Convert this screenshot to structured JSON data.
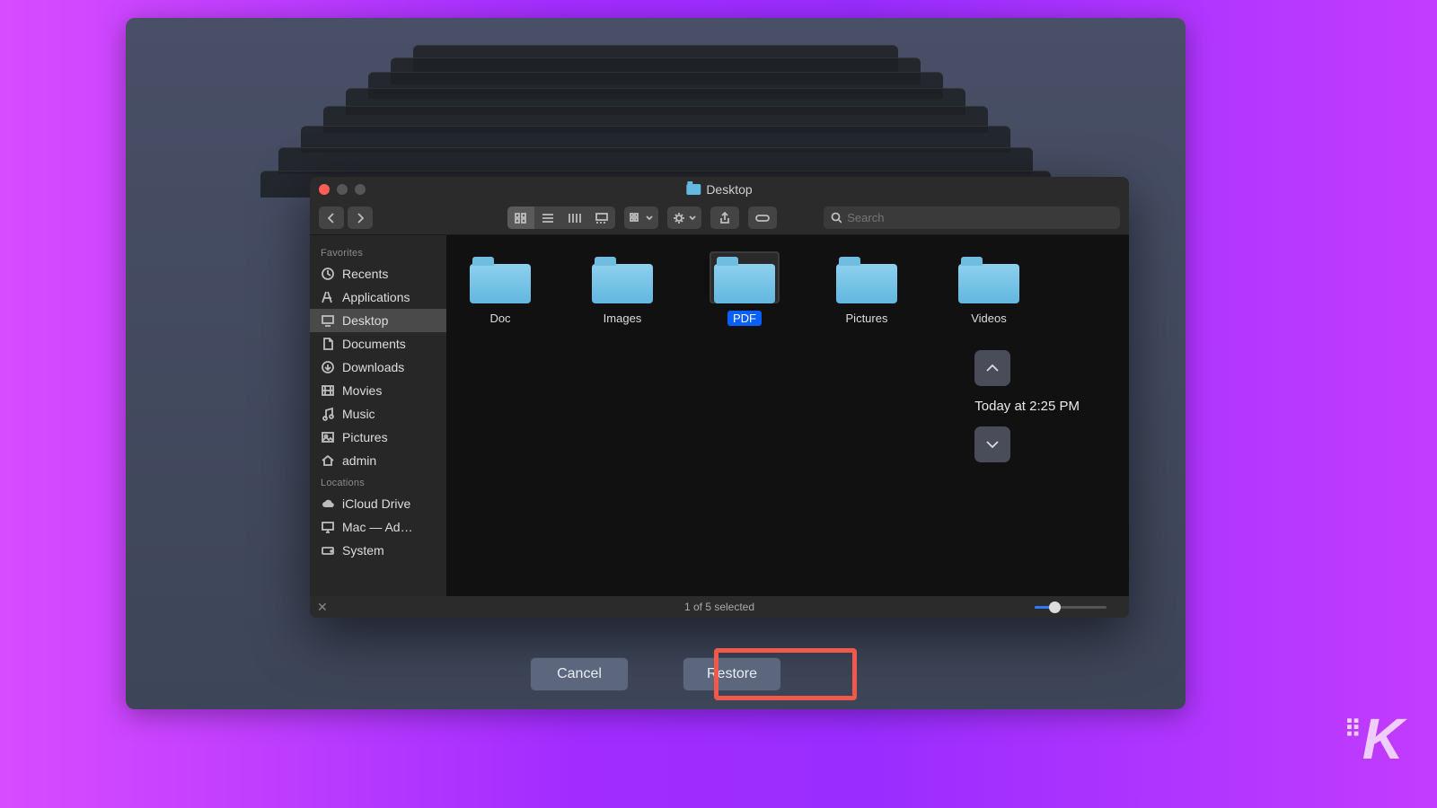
{
  "window": {
    "title": "Desktop"
  },
  "toolbar": {
    "search_placeholder": "Search"
  },
  "sidebar": {
    "favorites_header": "Favorites",
    "locations_header": "Locations",
    "favorites": [
      {
        "label": "Recents",
        "icon": "clock-icon"
      },
      {
        "label": "Applications",
        "icon": "apps-icon"
      },
      {
        "label": "Desktop",
        "icon": "desktop-icon",
        "selected": true
      },
      {
        "label": "Documents",
        "icon": "documents-icon"
      },
      {
        "label": "Downloads",
        "icon": "downloads-icon"
      },
      {
        "label": "Movies",
        "icon": "movies-icon"
      },
      {
        "label": "Music",
        "icon": "music-icon"
      },
      {
        "label": "Pictures",
        "icon": "pictures-icon"
      },
      {
        "label": "admin",
        "icon": "house-icon"
      }
    ],
    "locations": [
      {
        "label": "iCloud Drive",
        "icon": "cloud-icon"
      },
      {
        "label": "Mac — Ad…",
        "icon": "display-icon"
      },
      {
        "label": "System",
        "icon": "drive-icon"
      }
    ]
  },
  "folders": [
    {
      "label": "Doc"
    },
    {
      "label": "Images"
    },
    {
      "label": "PDF",
      "selected": true
    },
    {
      "label": "Pictures"
    },
    {
      "label": "Videos"
    }
  ],
  "status": {
    "text": "1 of 5 selected"
  },
  "timeline": {
    "label": "Today at 2:25 PM"
  },
  "buttons": {
    "cancel": "Cancel",
    "restore": "Restore"
  },
  "watermark": "K"
}
